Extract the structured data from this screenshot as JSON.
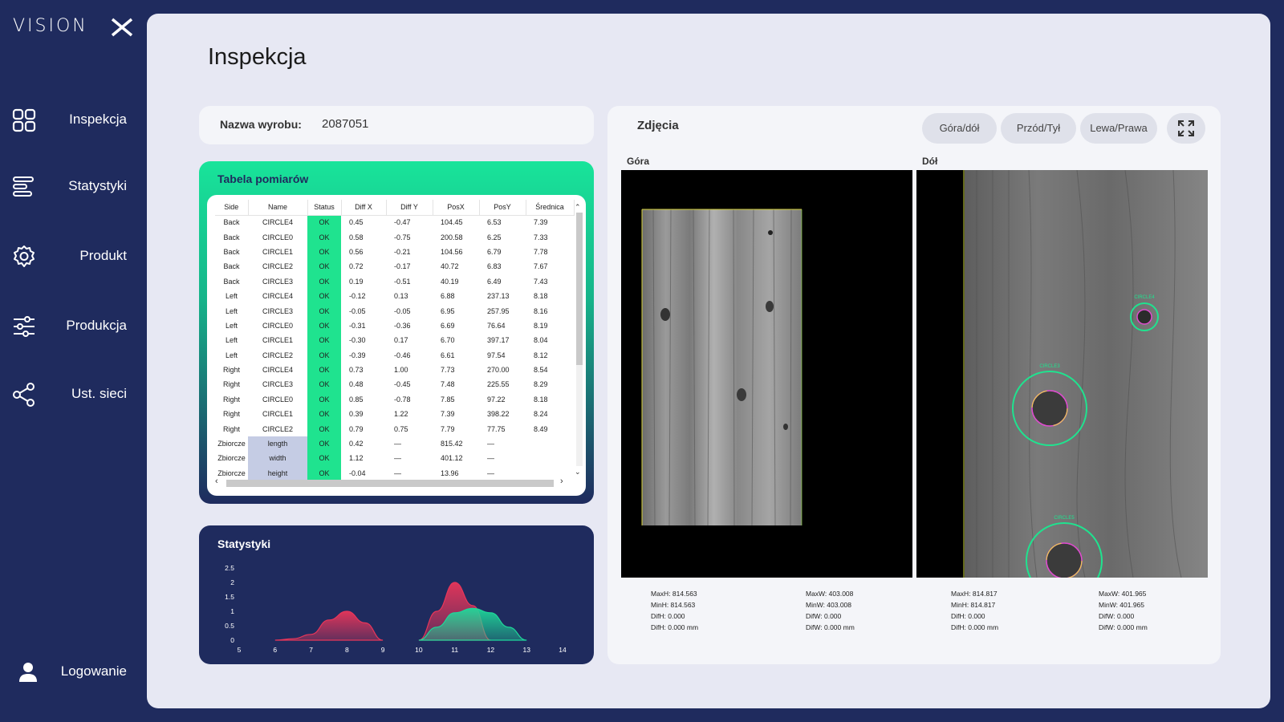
{
  "app": {
    "logo_text": "VISION"
  },
  "sidebar": {
    "items": [
      {
        "label": "Inspekcja",
        "icon": "grid-icon"
      },
      {
        "label": "Statystyki",
        "icon": "list-bars-icon"
      },
      {
        "label": "Produkt",
        "icon": "gear-icon"
      },
      {
        "label": "Produkcja",
        "icon": "sliders-icon"
      },
      {
        "label": "Ust. sieci",
        "icon": "share-network-icon"
      }
    ],
    "login": {
      "label": "Logowanie",
      "icon": "user-icon"
    }
  },
  "page": {
    "title": "Inspekcja"
  },
  "product": {
    "label": "Nazwa wyrobu:",
    "value": "2087051"
  },
  "measurements": {
    "title": "Tabela pomiarów",
    "columns": [
      "Side",
      "Name",
      "Status",
      "Diff X",
      "Diff Y",
      "PosX",
      "PosY",
      "Średnica"
    ],
    "rows": [
      [
        "Back",
        "CIRCLE4",
        "OK",
        "0.45",
        "-0.47",
        "104.45",
        "6.53",
        "7.39"
      ],
      [
        "Back",
        "CIRCLE0",
        "OK",
        "0.58",
        "-0.75",
        "200.58",
        "6.25",
        "7.33"
      ],
      [
        "Back",
        "CIRCLE1",
        "OK",
        "0.56",
        "-0.21",
        "104.56",
        "6.79",
        "7.78"
      ],
      [
        "Back",
        "CIRCLE2",
        "OK",
        "0.72",
        "-0.17",
        "40.72",
        "6.83",
        "7.67"
      ],
      [
        "Back",
        "CIRCLE3",
        "OK",
        "0.19",
        "-0.51",
        "40.19",
        "6.49",
        "7.43"
      ],
      [
        "Left",
        "CIRCLE4",
        "OK",
        "-0.12",
        "0.13",
        "6.88",
        "237.13",
        "8.18"
      ],
      [
        "Left",
        "CIRCLE3",
        "OK",
        "-0.05",
        "-0.05",
        "6.95",
        "257.95",
        "8.16"
      ],
      [
        "Left",
        "CIRCLE0",
        "OK",
        "-0.31",
        "-0.36",
        "6.69",
        "76.64",
        "8.19"
      ],
      [
        "Left",
        "CIRCLE1",
        "OK",
        "-0.30",
        "0.17",
        "6.70",
        "397.17",
        "8.04"
      ],
      [
        "Left",
        "CIRCLE2",
        "OK",
        "-0.39",
        "-0.46",
        "6.61",
        "97.54",
        "8.12"
      ],
      [
        "Right",
        "CIRCLE4",
        "OK",
        "0.73",
        "1.00",
        "7.73",
        "270.00",
        "8.54"
      ],
      [
        "Right",
        "CIRCLE3",
        "OK",
        "0.48",
        "-0.45",
        "7.48",
        "225.55",
        "8.29"
      ],
      [
        "Right",
        "CIRCLE0",
        "OK",
        "0.85",
        "-0.78",
        "7.85",
        "97.22",
        "8.18"
      ],
      [
        "Right",
        "CIRCLE1",
        "OK",
        "0.39",
        "1.22",
        "7.39",
        "398.22",
        "8.24"
      ],
      [
        "Right",
        "CIRCLE2",
        "OK",
        "0.79",
        "0.75",
        "7.79",
        "77.75",
        "8.49"
      ],
      [
        "Zbiorcze",
        "length",
        "OK",
        "0.42",
        "—",
        "815.42",
        "—",
        ""
      ],
      [
        "Zbiorcze",
        "width",
        "OK",
        "1.12",
        "—",
        "401.12",
        "—",
        ""
      ],
      [
        "Zbiorcze",
        "height",
        "OK",
        "-0.04",
        "—",
        "13.96",
        "—",
        ""
      ]
    ]
  },
  "stats": {
    "title": "Statystyki"
  },
  "chart_data": {
    "type": "area",
    "title": "Statystyki",
    "xlabel": "",
    "ylabel": "",
    "xlim": [
      5,
      14
    ],
    "ylim": [
      0,
      2.5
    ],
    "x_ticks": [
      "5",
      "6",
      "7",
      "8",
      "9",
      "10",
      "11",
      "12",
      "13",
      "14"
    ],
    "y_ticks": [
      "0",
      "0.5",
      "1",
      "1.5",
      "2",
      "2.5"
    ],
    "series": [
      {
        "color": "#e8365a",
        "x": [
          6.0,
          6.5,
          7.0,
          7.5,
          8.0,
          8.5,
          9.0
        ],
        "y": [
          0.0,
          0.05,
          0.2,
          0.7,
          1.0,
          0.6,
          0.0
        ]
      },
      {
        "color": "#e8365a",
        "x": [
          10.0,
          10.5,
          11.0,
          11.5,
          12.0
        ],
        "y": [
          0.0,
          1.0,
          2.0,
          1.2,
          0.0
        ]
      },
      {
        "color": "#1fd89a",
        "x": [
          10.0,
          10.5,
          11.0,
          11.5,
          12.0,
          12.5,
          13.0
        ],
        "y": [
          0.0,
          0.45,
          0.95,
          1.1,
          0.95,
          0.45,
          0.0
        ]
      }
    ]
  },
  "photos": {
    "title": "Zdjęcia",
    "buttons": [
      "Góra/dół",
      "Przód/Tył",
      "Lewa/Prawa"
    ],
    "fullscreen_icon": "expand-icon",
    "left": {
      "label": "Góra",
      "meta_h": [
        "MaxH: 814.563",
        "MinH: 814.563",
        "DifH: 0.000",
        "DifH: 0.000 mm"
      ],
      "meta_w": [
        "MaxW: 403.008",
        "MinW: 403.008",
        "DifW: 0.000",
        "DifW: 0.000 mm"
      ]
    },
    "right": {
      "label": "Dół",
      "circle_labels": [
        "CIRCLE4",
        "CIRCLE3",
        "CIRCLE5"
      ],
      "meta_h": [
        "MaxH: 814.817",
        "MinH: 814.817",
        "DifH: 0.000",
        "DifH: 0.000 mm"
      ],
      "meta_w": [
        "MaxW: 401.965",
        "MinW: 401.965",
        "DifW: 0.000",
        "DifW: 0.000 mm"
      ]
    }
  },
  "colors": {
    "navy": "#1f2b5e",
    "accent_green": "#1fe38f",
    "panel": "#e7e8f3",
    "ok": "#1fe38f",
    "chart_red": "#e8365a",
    "chart_green": "#1fd89a"
  }
}
